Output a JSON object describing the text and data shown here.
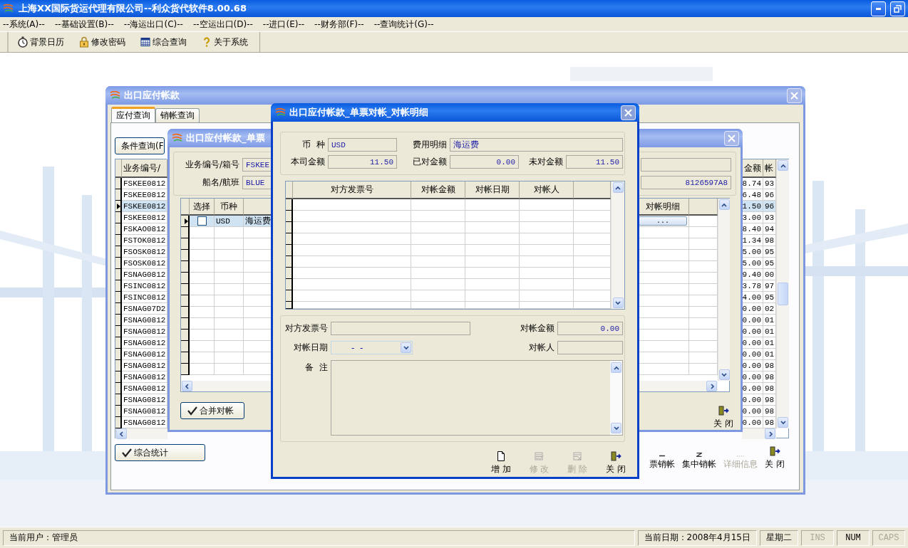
{
  "app": {
    "title": "上海XX国际货运代理有限公司--利众货代软件8.00.68"
  },
  "menu": [
    "--系统(A)--",
    "--基础设置(B)--",
    "--海运出口(C)--",
    "--空运出口(D)--",
    "--进口(E)--",
    "--财务部(F)--",
    "--查询统计(G)--"
  ],
  "toolbar": [
    "背景日历",
    "修改密码",
    "综合查询",
    "关于系统"
  ],
  "payables_window": {
    "title": "出口应付帐款",
    "tabs": [
      {
        "label": "应付查询",
        "selected": true
      },
      {
        "label": "销帐查询",
        "selected": false
      }
    ],
    "query_button": "条件查询(F",
    "columns": [
      "业务编号/",
      "金额",
      "帐"
    ],
    "rows": [
      {
        "id": "FSKEE0812",
        "amount": "8.74",
        "age": "93",
        "selected": false
      },
      {
        "id": "FSKEE0812",
        "amount": "6.48",
        "age": "96",
        "selected": false
      },
      {
        "id": "FSKEE0812",
        "amount": "1.50",
        "age": "96",
        "selected": true
      },
      {
        "id": "FSKEE0812",
        "amount": "3.00",
        "age": "93",
        "selected": false
      },
      {
        "id": "FSKAO0812",
        "amount": "8.40",
        "age": "94",
        "selected": false
      },
      {
        "id": "FSTOK0812",
        "amount": "1.34",
        "age": "98",
        "selected": false
      },
      {
        "id": "FSOSK0812",
        "amount": "5.00",
        "age": "95",
        "selected": false
      },
      {
        "id": "FSOSK0812",
        "amount": "5.00",
        "age": "95",
        "selected": false
      },
      {
        "id": "FSNAG0812",
        "amount": "9.40",
        "age": "00",
        "selected": false
      },
      {
        "id": "FSINC0812",
        "amount": "3.78",
        "age": "97",
        "selected": false
      },
      {
        "id": "FSINC0812",
        "amount": "4.00",
        "age": "95",
        "selected": false
      },
      {
        "id": "FSNAG07D2",
        "amount": "0.00",
        "age": "02",
        "selected": false
      },
      {
        "id": "FSNAG0812",
        "amount": "0.00",
        "age": "01",
        "selected": false
      },
      {
        "id": "FSNAG0812",
        "amount": "0.00",
        "age": "01",
        "selected": false
      },
      {
        "id": "FSNAG0812",
        "amount": "0.00",
        "age": "01",
        "selected": false
      },
      {
        "id": "FSNAG0812",
        "amount": "0.00",
        "age": "01",
        "selected": false
      },
      {
        "id": "FSNAG0812",
        "amount": "0.00",
        "age": "98",
        "selected": false
      },
      {
        "id": "FSNAG0812",
        "amount": "0.00",
        "age": "98",
        "selected": false
      },
      {
        "id": "FSNAG0812",
        "amount": "0.00",
        "age": "98",
        "selected": false
      },
      {
        "id": "FSNAG0812",
        "amount": "0.00",
        "age": "98",
        "selected": false
      },
      {
        "id": "FSNAG0812",
        "amount": "0.00",
        "age": "98",
        "selected": false
      },
      {
        "id": "FSNAG0812",
        "amount": "0.00",
        "age": "98",
        "selected": false
      }
    ],
    "summary_button": "综合统计",
    "actions": [
      {
        "label": "票销帐",
        "disabled": false
      },
      {
        "label": "集中销帐",
        "disabled": false
      },
      {
        "label": "详细信息",
        "disabled": true
      },
      {
        "label": "关 闭",
        "disabled": false
      }
    ]
  },
  "single_window": {
    "title": "出口应付帐款_单票",
    "fields": [
      {
        "label": "业务编号/箱号",
        "value_start": "FSKEE"
      },
      {
        "label": "船名/航班",
        "value_start": "BLUE",
        "value_end": "8126597A8"
      }
    ],
    "columns": [
      "选择",
      "币种",
      "对帐明细"
    ],
    "rows": [
      {
        "checked": false,
        "currency": "USD",
        "item": "海运费",
        "detail": "...",
        "selected": true
      }
    ],
    "merge_button": "合并对帐",
    "close_button": "关 闭"
  },
  "detail_window": {
    "title": "出口应付帐款_单票对帐_对帐明细",
    "summary": [
      {
        "label": "币  种",
        "value": "USD",
        "kind": "text"
      },
      {
        "label": "费用明细",
        "value": "海运费",
        "kind": "wide"
      },
      {
        "label": "本司金额",
        "value": "11.50",
        "kind": "amount"
      },
      {
        "label": "已对金额",
        "value": "0.00",
        "kind": "amount"
      },
      {
        "label": "未对金额",
        "value": "11.50",
        "kind": "amount"
      }
    ],
    "columns": [
      "对方发票号",
      "对帐金额",
      "对帐日期",
      "对帐人"
    ],
    "form": {
      "invoice_label": "对方发票号",
      "amount_label": "对帐金额",
      "amount": "0.00",
      "date_label": "对帐日期",
      "date": "-  -",
      "person_label": "对帐人",
      "note_label": "备  注"
    },
    "buttons": [
      {
        "label": "增 加",
        "disabled": false
      },
      {
        "label": "修 改",
        "disabled": true
      },
      {
        "label": "删 除",
        "disabled": true
      },
      {
        "label": "关 闭",
        "disabled": false
      }
    ]
  },
  "status_bar": {
    "user": "当前用户：管理员",
    "date": "当前日期：2008年4月15日",
    "weekday": "星期二",
    "indicators": [
      {
        "label": "INS",
        "on": false
      },
      {
        "label": "NUM",
        "on": true
      },
      {
        "label": "CAPS",
        "on": false
      }
    ]
  }
}
